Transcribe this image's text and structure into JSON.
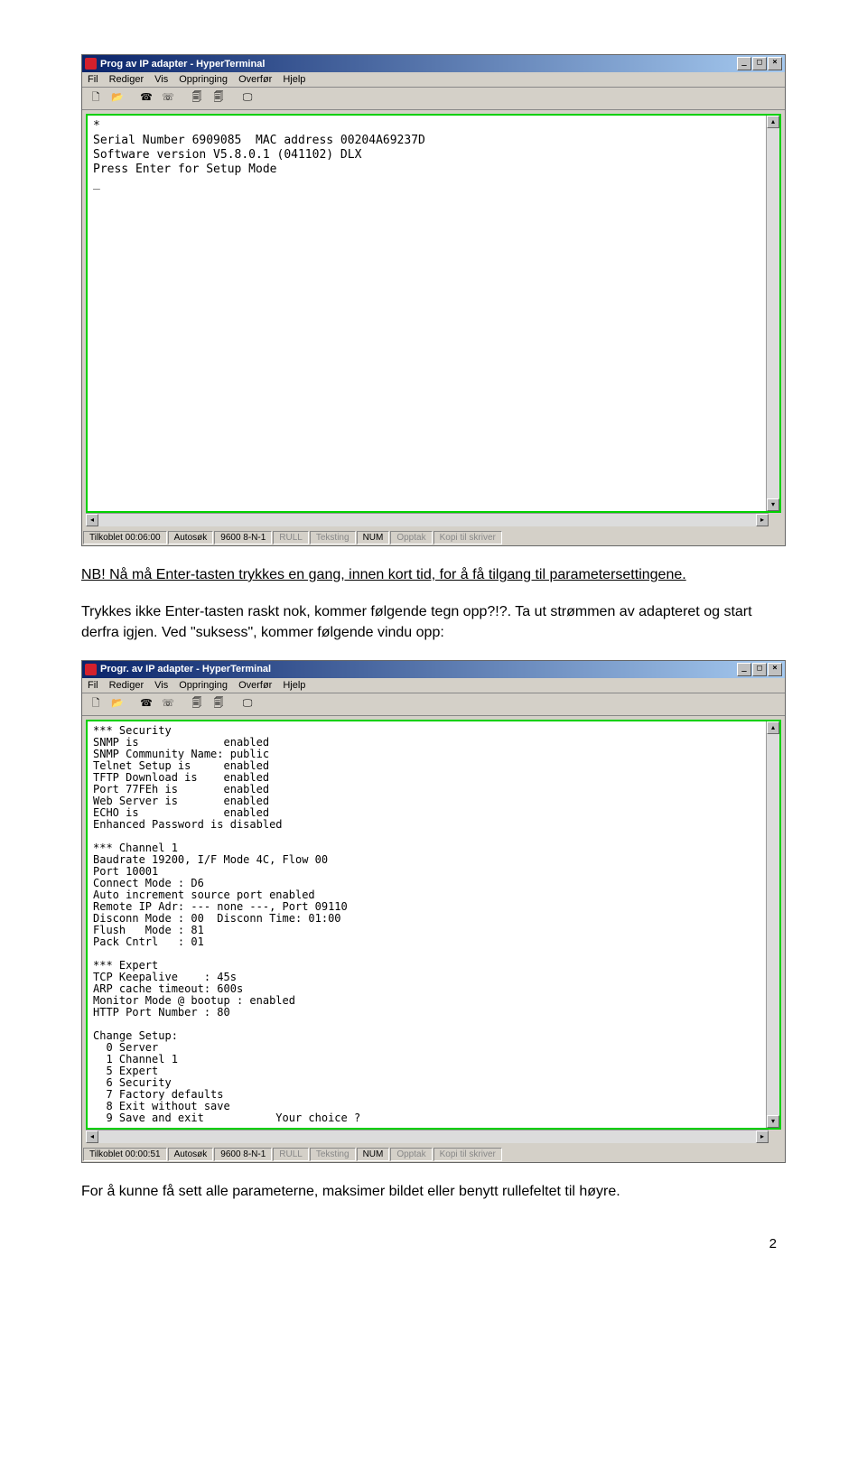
{
  "window1": {
    "title": "Prog av IP adapter - HyperTerminal",
    "menu": [
      "Fil",
      "Rediger",
      "Vis",
      "Oppringing",
      "Overfør",
      "Hjelp"
    ],
    "terminal": "*\nSerial Number 6909085  MAC address 00204A69237D\nSoftware version V5.8.0.1 (041102) DLX\nPress Enter for Setup Mode\n_",
    "status": {
      "s1": "Tilkoblet 00:06:00",
      "s2": "Autosøk",
      "s3": "9600 8-N-1",
      "s4": "RULL",
      "s5": "Teksting",
      "s6": "NUM",
      "s7": "Opptak",
      "s8": "Kopi til skriver"
    }
  },
  "para1a": "NB! Nå må Enter-tasten trykkes en gang, innen kort tid, for å få tilgang til parametersettingene.",
  "para2": "Trykkes ikke Enter-tasten raskt nok, kommer følgende tegn opp?!?. Ta ut strømmen av adapteret og start derfra igjen. Ved \"suksess\", kommer følgende vindu opp:",
  "window2": {
    "title": "Progr. av IP adapter - HyperTerminal",
    "menu": [
      "Fil",
      "Rediger",
      "Vis",
      "Oppringing",
      "Overfør",
      "Hjelp"
    ],
    "terminal": "*** Security\nSNMP is             enabled\nSNMP Community Name: public\nTelnet Setup is     enabled\nTFTP Download is    enabled\nPort 77FEh is       enabled\nWeb Server is       enabled\nECHO is             enabled\nEnhanced Password is disabled\n\n*** Channel 1\nBaudrate 19200, I/F Mode 4C, Flow 00\nPort 10001\nConnect Mode : D6\nAuto increment source port enabled\nRemote IP Adr: --- none ---, Port 09110\nDisconn Mode : 00  Disconn Time: 01:00\nFlush   Mode : 81\nPack Cntrl   : 01\n\n*** Expert\nTCP Keepalive    : 45s\nARP cache timeout: 600s\nMonitor Mode @ bootup : enabled\nHTTP Port Number : 80\n\nChange Setup:\n  0 Server\n  1 Channel 1\n  5 Expert\n  6 Security\n  7 Factory defaults\n  8 Exit without save\n  9 Save and exit           Your choice ?",
    "status": {
      "s1": "Tilkoblet 00:00:51",
      "s2": "Autosøk",
      "s3": "9600 8-N-1",
      "s4": "RULL",
      "s5": "Teksting",
      "s6": "NUM",
      "s7": "Opptak",
      "s8": "Kopi til skriver"
    }
  },
  "para3": "For å kunne få sett alle parameterne, maksimer bildet eller benytt rullefeltet til høyre.",
  "page_number": "2"
}
